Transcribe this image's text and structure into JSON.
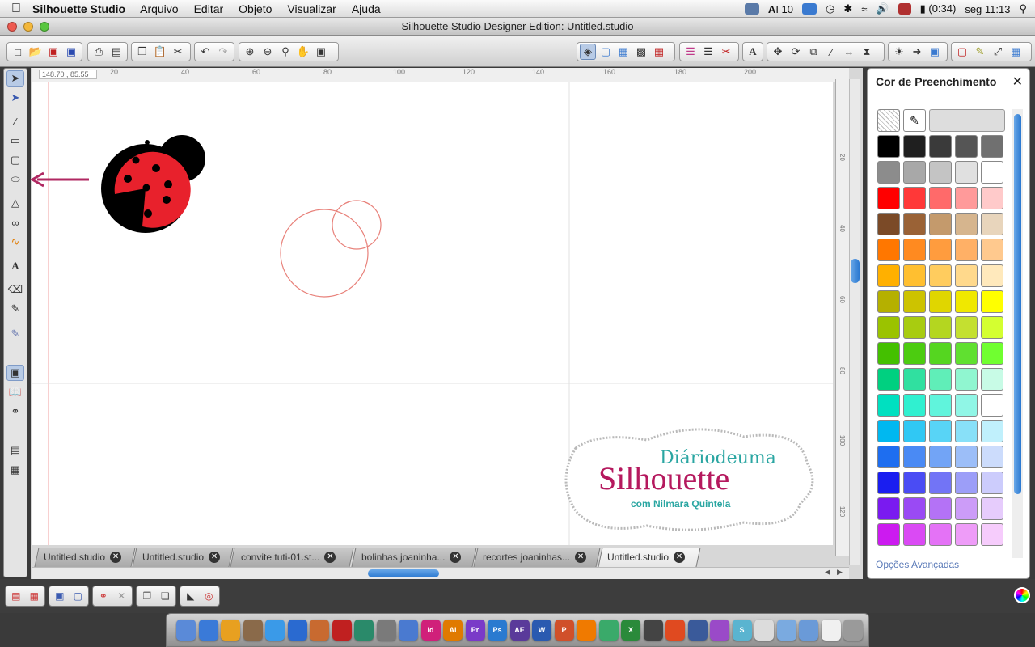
{
  "menubar": {
    "app_name": "Silhouette Studio",
    "items": [
      "Arquivo",
      "Editar",
      "Objeto",
      "Visualizar",
      "Ajuda"
    ],
    "tray": {
      "ai_count": "10",
      "battery": "(0:34)",
      "clock": "seg 11:13"
    }
  },
  "window": {
    "title": "Silhouette Studio Designer Edition: Untitled.studio"
  },
  "toolbar": {
    "left_icons": [
      "new-icon",
      "open-icon",
      "save-icon",
      "save-3d-icon",
      "print-icon",
      "send-to-cutter-icon",
      "copy-icon",
      "paste-icon",
      "cut-icon",
      "undo-icon",
      "redo-icon",
      "zoom-in-icon",
      "zoom-out-icon",
      "zoom-region-icon",
      "pan-icon",
      "fit-page-icon"
    ],
    "right_icons": [
      "fill-color-icon",
      "line-color-icon",
      "pattern-icon",
      "gradient-icon",
      "line-style-icon",
      "align-icon",
      "text-style-icon",
      "transform-icon",
      "replicate-icon",
      "modify-icon",
      "offset-icon",
      "trace-icon",
      "library-icon",
      "store-icon",
      "design-page-icon",
      "cut-settings-icon",
      "sketch-icon",
      "fullscreen-icon",
      "grid-icon"
    ]
  },
  "canvas": {
    "coord_readout": "148.70 , 85.55",
    "ruler_h": [
      "20",
      "40",
      "60",
      "80",
      "100",
      "120",
      "140",
      "160",
      "180",
      "200"
    ],
    "ruler_v": [
      "20",
      "40",
      "60",
      "80",
      "100",
      "120"
    ],
    "watermark": {
      "line1": "Diáriodeuma",
      "line2": "Silhouette",
      "line3": "com Nilmara Quintela"
    },
    "colors": {
      "ladybug_red": "#e8212c",
      "circle_stroke": "#e8817a",
      "arrow": "#b02862",
      "watermark_pink": "#b5195e",
      "watermark_teal": "#2aa6a2"
    }
  },
  "doc_tabs": [
    "Untitled.studio",
    "Untitled.studio",
    "convite tuti-01.st...",
    "bolinhas joaninha...",
    "recortes joaninhas...",
    "Untitled.studio"
  ],
  "panel": {
    "title": "Cor de Preenchimento",
    "link": "Opções Avançadas",
    "swatch_rows": [
      [
        "#000000",
        "#1f1f1f",
        "#3a3a3a",
        "#555555",
        "#707070"
      ],
      [
        "#8c8c8c",
        "#a8a8a8",
        "#c4c4c4",
        "#e0e0e0",
        "#ffffff"
      ],
      [
        "#ff0000",
        "#ff3838",
        "#ff6a6a",
        "#ff9a9a",
        "#ffcaca"
      ],
      [
        "#7b4a27",
        "#9a6236",
        "#c49a6c",
        "#d6b58e",
        "#e8d5bc"
      ],
      [
        "#ff7700",
        "#ff8a20",
        "#ff9c3e",
        "#ffb066",
        "#ffc98e"
      ],
      [
        "#ffb000",
        "#ffbf30",
        "#ffcc5e",
        "#ffd98c",
        "#ffe9bc"
      ],
      [
        "#b5b000",
        "#cdc300",
        "#e0d600",
        "#f0e800",
        "#ffff00"
      ],
      [
        "#9bc300",
        "#a8cc10",
        "#b4d620",
        "#c4e030",
        "#d4ff30"
      ],
      [
        "#44c000",
        "#4ccc10",
        "#55d620",
        "#60e030",
        "#70ff30"
      ],
      [
        "#00d080",
        "#30e0a0",
        "#60eeb8",
        "#90f6d0",
        "#c8fbe6"
      ],
      [
        "#00e0c0",
        "#30f0d0",
        "#60f4dc",
        "#90f6e6",
        "#ffffff"
      ],
      [
        "#00b8f0",
        "#30c8f4",
        "#58d4f6",
        "#88e0f8",
        "#c0f0fc"
      ],
      [
        "#1e6ef0",
        "#4a8af4",
        "#72a4f6",
        "#9cbef8",
        "#ccdcfc"
      ],
      [
        "#1a1ef0",
        "#4a4cf4",
        "#7274f6",
        "#9c9ef8",
        "#ccccfc"
      ],
      [
        "#7a1af0",
        "#9a4af4",
        "#b472f6",
        "#cc9cf8",
        "#e6ccfc"
      ],
      [
        "#cc1af0",
        "#da4af4",
        "#e472f6",
        "#ee9cf8",
        "#f6ccfc"
      ]
    ]
  },
  "bottom_icons": [
    "group-icon",
    "ungroup-icon",
    "make-compound-icon",
    "release-compound-icon",
    "weld-icon",
    "delete-icon",
    "duplicate-icon",
    "mirror-icon",
    "bring-front-icon",
    "print-cut-icon"
  ],
  "dock_icons": [
    {
      "name": "finder-icon",
      "color": "#5a8ad8",
      "label": ""
    },
    {
      "name": "app-store-icon",
      "color": "#3a7ad8",
      "label": ""
    },
    {
      "name": "chrome-icon",
      "color": "#e8a020",
      "label": ""
    },
    {
      "name": "photos-icon",
      "color": "#8a6a4a",
      "label": ""
    },
    {
      "name": "safari-icon",
      "color": "#3a9ae8",
      "label": ""
    },
    {
      "name": "itunes-icon",
      "color": "#2a6ad0",
      "label": ""
    },
    {
      "name": "iphoto-icon",
      "color": "#c86a30",
      "label": ""
    },
    {
      "name": "photo-booth-icon",
      "color": "#c02020",
      "label": ""
    },
    {
      "name": "time-machine-icon",
      "color": "#2a8a6a",
      "label": ""
    },
    {
      "name": "system-prefs-icon",
      "color": "#7a7a7a",
      "label": ""
    },
    {
      "name": "bridge-icon",
      "color": "#4a7ad0",
      "label": ""
    },
    {
      "name": "indesign-icon",
      "color": "#d0207a",
      "label": "Id"
    },
    {
      "name": "illustrator-icon",
      "color": "#e07a00",
      "label": "Ai"
    },
    {
      "name": "premiere-icon",
      "color": "#7a3ac8",
      "label": "Pr"
    },
    {
      "name": "photoshop-icon",
      "color": "#2a7ad0",
      "label": "Ps"
    },
    {
      "name": "after-effects-icon",
      "color": "#5a3a9a",
      "label": "AE"
    },
    {
      "name": "word-icon",
      "color": "#2a5ab0",
      "label": "W"
    },
    {
      "name": "powerpoint-icon",
      "color": "#d0502a",
      "label": "P"
    },
    {
      "name": "vlc-icon",
      "color": "#f07a00",
      "label": ""
    },
    {
      "name": "utility-icon",
      "color": "#3aaa6a",
      "label": ""
    },
    {
      "name": "excel-icon",
      "color": "#2a8a3a",
      "label": "X"
    },
    {
      "name": "dvd-icon",
      "color": "#444444",
      "label": ""
    },
    {
      "name": "firefox-icon",
      "color": "#e04a20",
      "label": ""
    },
    {
      "name": "screen-icon",
      "color": "#3a5a9a",
      "label": ""
    },
    {
      "name": "picasa-icon",
      "color": "#9a4ac8",
      "label": ""
    },
    {
      "name": "silhouette-icon",
      "color": "#5ab4d0",
      "label": "S"
    },
    {
      "name": "preview-icon",
      "color": "#dcdcdc",
      "label": ""
    },
    {
      "name": "folder-icon",
      "color": "#7aaae0",
      "label": ""
    },
    {
      "name": "applications-icon",
      "color": "#6a9ad8",
      "label": ""
    },
    {
      "name": "document-icon",
      "color": "#f0f0f0",
      "label": ""
    },
    {
      "name": "trash-icon",
      "color": "#9a9a9a",
      "label": ""
    }
  ]
}
